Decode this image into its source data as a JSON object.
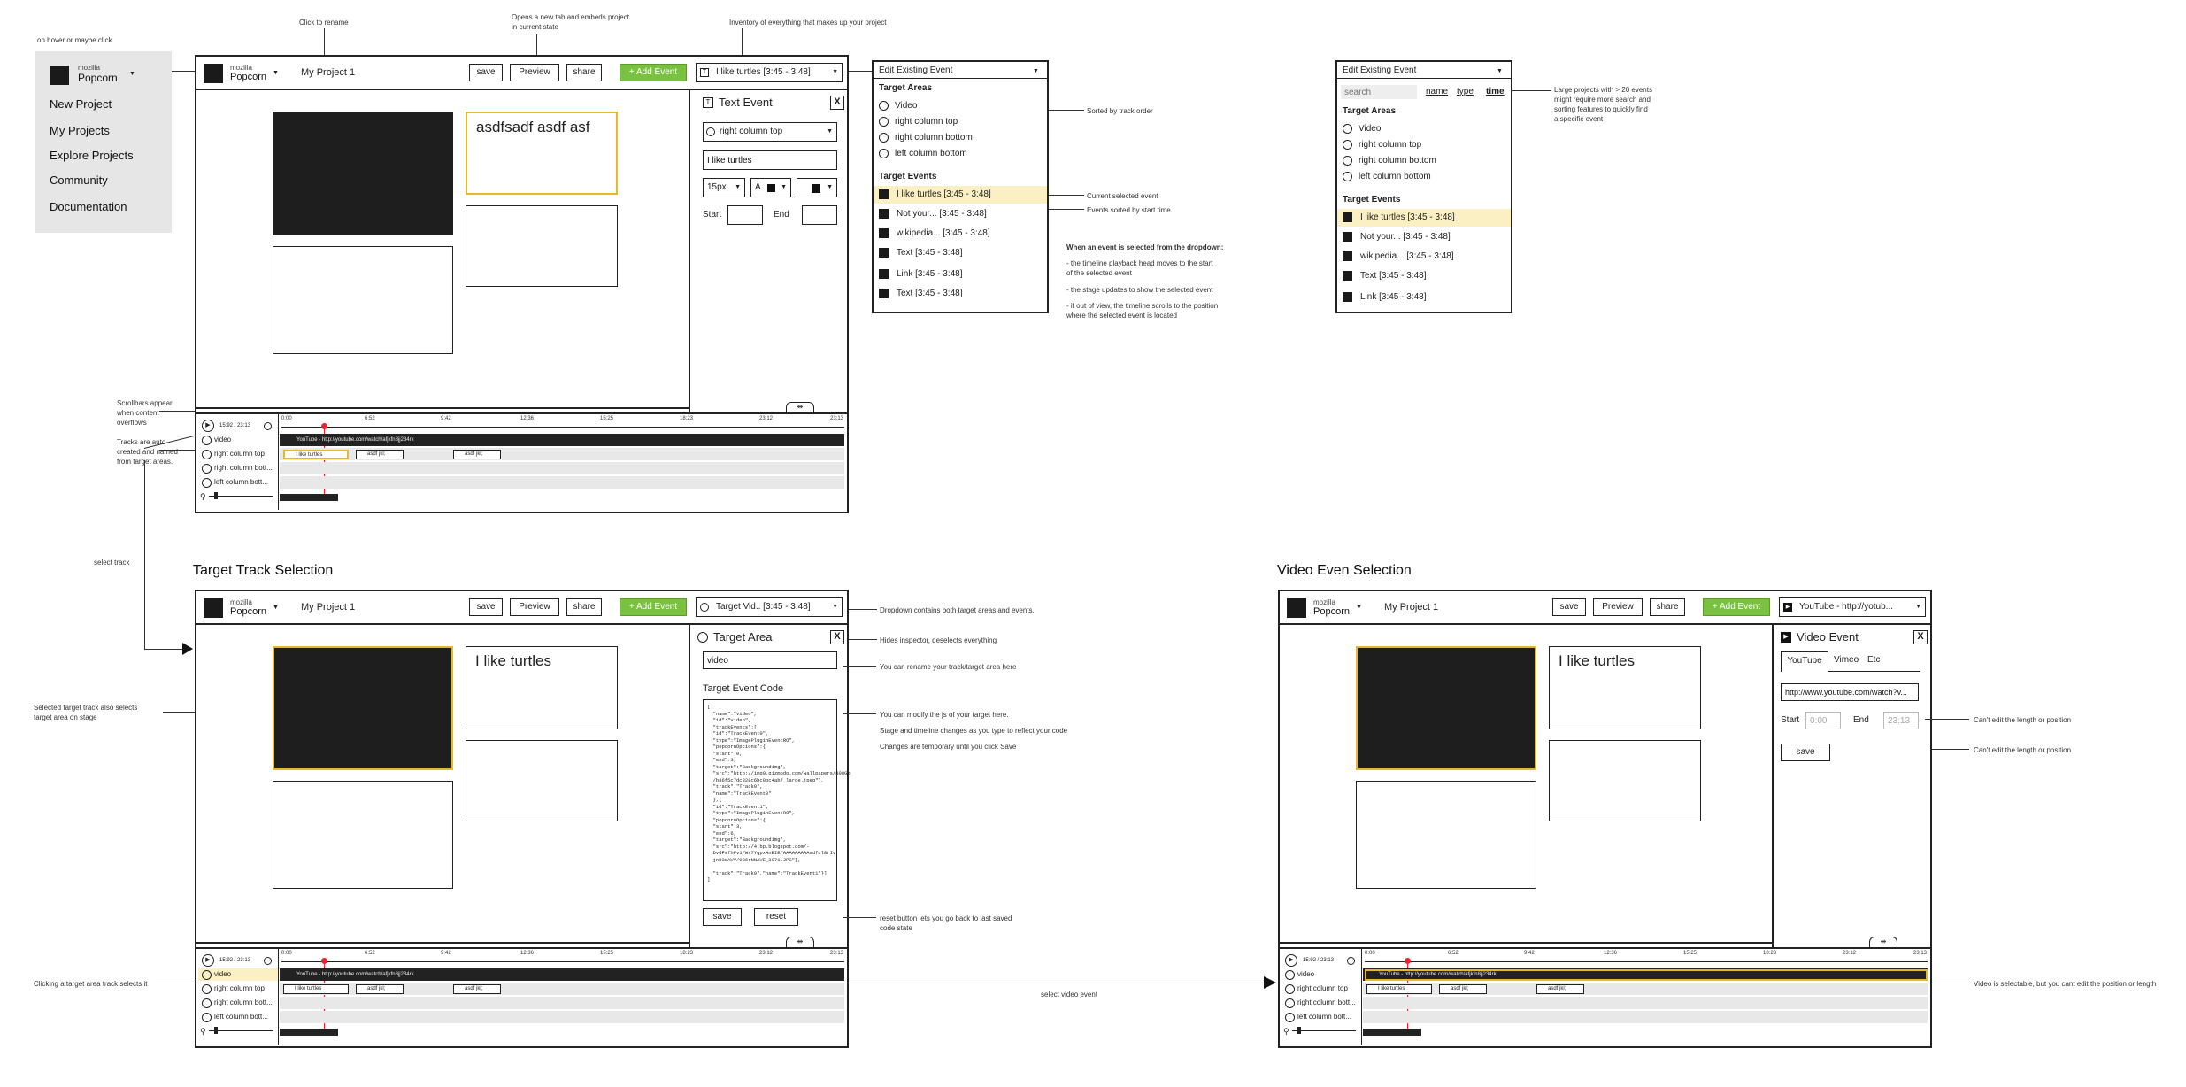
{
  "menu": {
    "logo_small": "mozilla",
    "logo_big": "Popcorn",
    "items": [
      "New Project",
      "My Projects",
      "Explore Projects",
      "Community",
      "Documentation"
    ]
  },
  "editor": {
    "project": "My Project 1",
    "save": "save",
    "preview": "Preview",
    "share": "share",
    "add_event": "+ Add Event"
  },
  "notes": {
    "hover": "on hover or maybe click",
    "rename": "Click to rename",
    "preview": "Opens a new tab and embeds project\nin current state",
    "inventory": "Inventory of everything that makes up your project",
    "scrollbars": "Scrollbars appear\nwhen content\noverflows",
    "tracks": "Tracks are auto\ncreated and named\nfrom target areas.",
    "select_track": "select track",
    "sorted_track": "Sorted by track order",
    "current_event": "Current selected event",
    "sorted_time": "Events sorted by start time",
    "when_title": "When an event is selected from the dropdown:",
    "when_1": "- the timeline playback head moves to the start\n  of the selected event",
    "when_2": "- the stage updates to show the selected event",
    "when_3": "- if out of view, the timeline scrolls to the position\n  where the selected event is located",
    "large": "Large projects with > 20 events\nmight require more search and\nsorting features to quickly find\na specific event",
    "dropdown_contains": "Dropdown contains both target areas and events.",
    "hides": "Hides inspector, deselects everything",
    "rename_track": "You can rename your track/target area here",
    "modify_js": "You can modify the js of your target here.",
    "stage_changes": "Stage and timeline changes as you type to reflect your code",
    "temporary": "Changes are temporary until you click Save",
    "reset": "reset button lets you go back to last saved\ncode state",
    "selected_target": "Selected target track also selects\ntarget area on stage",
    "clicking": "Clicking a target area track selects it",
    "select_video": "select video event",
    "cant_edit1": "Can't edit the length or position",
    "cant_edit2": "Can't edit the length or position",
    "video_selectable": "Video is selectable, but you cant edit the position or length"
  },
  "headings": {
    "target_track": "Target Track Selection",
    "video_even": "Video Even Selection"
  },
  "screen1": {
    "event_select": "I like turtles [3:45  - 3:48]",
    "stage_text": "asdfsadf asdf asf",
    "inspector": {
      "title": "Text Event",
      "close": "X",
      "target": "right column top",
      "text": "I like turtles",
      "size": "15px",
      "font": "A",
      "start": "Start",
      "end": "End"
    }
  },
  "screen2": {
    "event_select": "Target Vid.. [3:45  - 3:48]",
    "stage_text": "I like turtles",
    "inspector": {
      "title": "Target Area",
      "close": "X",
      "name": "video",
      "code_label": "Target Event Code",
      "save": "save",
      "reset": "reset",
      "code": "[\n  \"name\":\"video\",\n  \"id\":\"video\",\n  \"trackEvents\":[\n  \"id\":\"TrackEvent0\",\n  \"type\":\"ImagePluginEventRO\",\n  \"popcornOptions\":{\n  \"start\":0,\n  \"end\":3,\n  \"target\":\"Backgroundimg\",\n  \"src\":\"http://img0.gizmodo.com/wallpapers/808Go\n  /b86f5c7dc828c6bc0bc4ab7_large.jpeg\"},\n  \"track\":\"Track0\",\n  \"name\":\"TrackEvent0\"\n  },{\n  \"id\":\"TrackEvent1\",\n  \"type\":\"ImagePluginEventRO\",\n  \"popcornOptions\":{\n  \"start\":3,\n  \"end\":6,\n  \"target\":\"Backgroundimg\",\n  \"src\":\"http://4.bp.blogspot.com/-\n  DvdFsfhFv1/Ws7Ygpx4nBIE/AAAAAAAAAsdfcl8rIv\n  jnD3dAVV/986rNNAVE_3071.JPG\"},\n\n  \"track\":\"Track0\",\"name\":\"TrackEvent1\"}]\n]"
    }
  },
  "screen3": {
    "event_select": "YouTube - http://yotub...",
    "stage_text": "I like turtles",
    "inspector": {
      "title": "Video Event",
      "close": "X",
      "tabs": [
        "YouTube",
        "Vimeo",
        "Etc"
      ],
      "url": "http://www.youtube.com/watch?v...",
      "start": "Start",
      "start_val": "0:00",
      "end": "End",
      "end_val": "23:13",
      "save": "save"
    }
  },
  "dropdown": {
    "title": "Edit Existing Event",
    "areas_label": "Target Areas",
    "areas": [
      "Video",
      "right column top",
      "right column bottom",
      "left column bottom"
    ],
    "events_label": "Target Events",
    "events": [
      "I like turtles [3:45  - 3:48]",
      "Not your... [3:45  - 3:48]",
      "wikipedia... [3:45  - 3:48]",
      "Text [3:45  - 3:48]",
      "Link [3:45  - 3:48]",
      "Text [3:45  - 3:48]"
    ]
  },
  "dropdown2": {
    "title": "Edit Existing Event",
    "search": "search",
    "sort": [
      "name",
      "type",
      "time"
    ],
    "areas_label": "Target Areas",
    "areas": [
      "Video",
      "right column top",
      "right column bottom",
      "left column bottom"
    ],
    "events_label": "Target Events",
    "events": [
      "I like turtles [3:45  - 3:48]",
      "Not your... [3:45  - 3:48]",
      "wikipedia... [3:45  - 3:48]",
      "Text [3:45  - 3:48]",
      "Link [3:45  - 3:48]"
    ]
  },
  "timeline": {
    "time": "15:92 / 23:13",
    "ticks": [
      "0:00",
      "6:52",
      "9:42",
      "12:36",
      "15:25",
      "18:23",
      "23:12",
      "23:13"
    ],
    "tracks": [
      "video",
      "right column top",
      "right column bott...",
      "left column bott..."
    ],
    "video_chip": "YouTube - http://youtube.com/watch/afjkfn8jj234rk",
    "chip1": "I like turtles",
    "chip2": "asdf jkl;",
    "chip3": "asdf jkl;"
  }
}
